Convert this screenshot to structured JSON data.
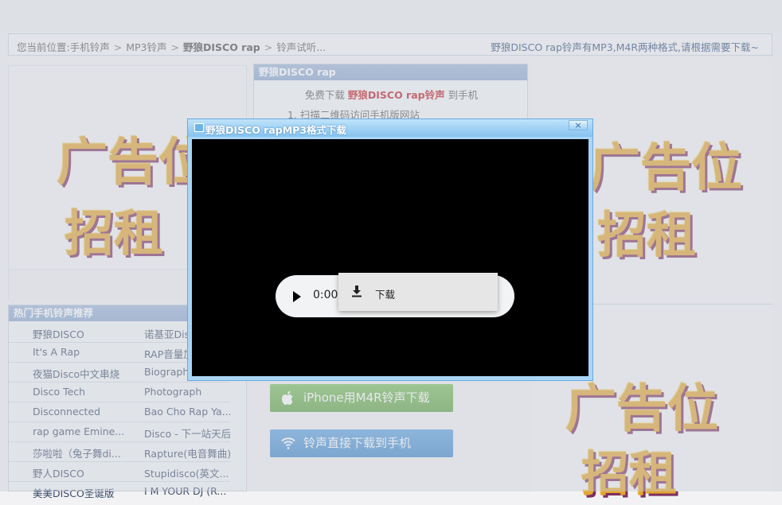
{
  "breadcrumb": {
    "prefix": "您当前位置:",
    "items": [
      "手机铃声",
      "MP3铃声",
      "野狼DISCO rap",
      "铃声试听..."
    ],
    "separator": ">",
    "right_text": "野狼DISCO rap铃声有MP3,M4R两种格式,请根据需要下载~"
  },
  "ads": {
    "line1": "广告位",
    "line2": "招租"
  },
  "hot_list": {
    "title": "热门手机铃声推荐",
    "rows": [
      [
        "野狼DISCO",
        "诺基亚Dis"
      ],
      [
        "It's A Rap",
        "RAP音量加"
      ],
      [
        "夜猫Disco中文串烧",
        "Biograph"
      ],
      [
        "Disco Tech",
        "Photograph"
      ],
      [
        "Disconnected",
        "Bao Cho Rap Ya..."
      ],
      [
        "rap game Emine...",
        "Disco - 下一站天后"
      ],
      [
        "莎啦啦（兔子舞di...",
        "Rapture(电音舞曲)"
      ],
      [
        "野人DISCO",
        "Stupidisco(英文..."
      ],
      [
        "美美DISCO圣诞版",
        "I M YOUR DJ (R..."
      ]
    ]
  },
  "download_box": {
    "title": "野狼DISCO rap",
    "line_prefix": "免费下载",
    "line_highlight": "野狼DISCO rap铃声",
    "line_suffix": "到手机",
    "step1": "1. 扫描二维码访问手机版网站"
  },
  "buttons": {
    "iphone": "iPhone用M4R铃声下载",
    "direct": "铃声直接下载到手机"
  },
  "dialog": {
    "title": "野狼DISCO rapMP3格式下载",
    "close": "×",
    "player_time": "0:00 /",
    "menu_download": "下载"
  },
  "colors": {
    "accent_red": "#c0191f",
    "header_blue": "#8aa6cf",
    "button_green": "#5fa243",
    "button_blue": "#3f87cc",
    "dialog_border": "#66a9e0"
  }
}
